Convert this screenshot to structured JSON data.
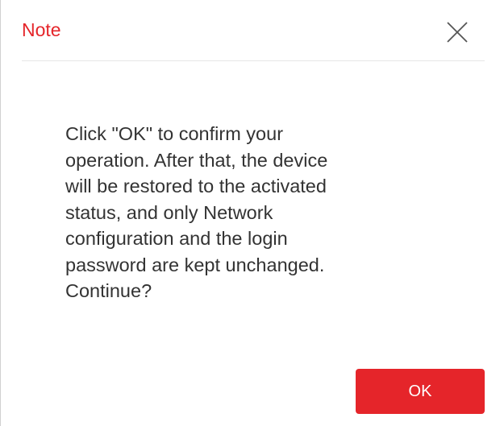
{
  "dialog": {
    "title": "Note",
    "close_icon": "close-icon",
    "message_lines": [
      "Click \"OK\" to confirm your",
      "operation. After that, the device",
      "will be restored to the activated",
      "status, and only Network",
      "configuration and the login",
      "password are kept unchanged.",
      "Continue?"
    ],
    "ok_label": "OK"
  },
  "colors": {
    "accent": "#e5252a",
    "text": "#333333",
    "divider": "#e6e6e6"
  }
}
